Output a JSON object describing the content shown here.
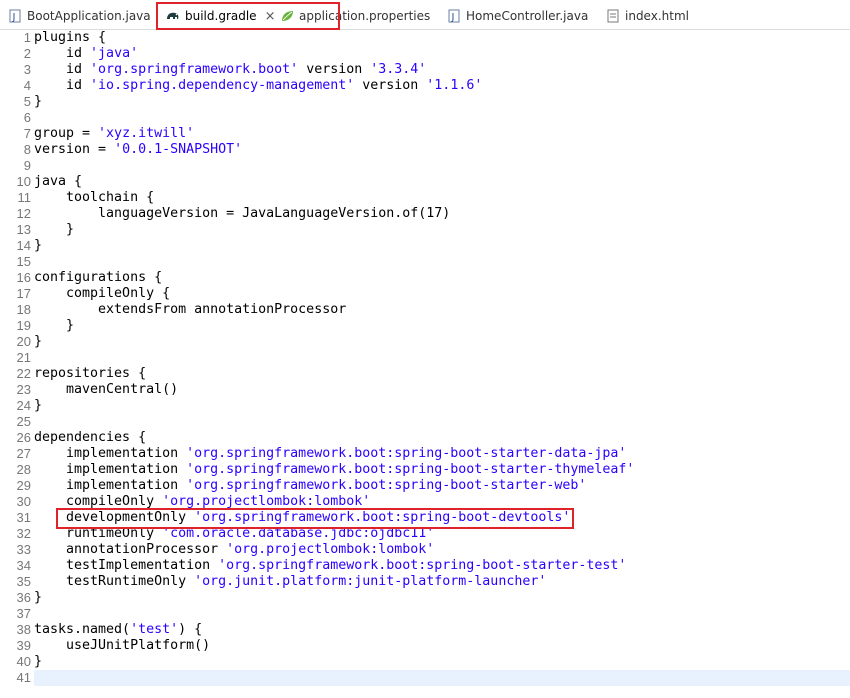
{
  "tabs": [
    {
      "label": "BootApplication.java",
      "icon": "java-file-icon",
      "active": false
    },
    {
      "label": "build.gradle",
      "icon": "gradle-elephant-icon",
      "active": true,
      "close": "×"
    },
    {
      "label": "application.properties",
      "icon": "spring-leaf-icon",
      "active": false
    },
    {
      "label": "HomeController.java",
      "icon": "java-file-icon",
      "active": false
    },
    {
      "label": "index.html",
      "icon": "html-file-icon",
      "active": false
    }
  ],
  "colors": {
    "string": "#2a00ff",
    "line_number": "#787878",
    "highlight_border": "#e0222a",
    "current_line": "#e8f2fe"
  },
  "editor": {
    "lines": [
      {
        "n": "1",
        "tokens": [
          [
            "plugins {",
            "p"
          ]
        ]
      },
      {
        "n": "2",
        "tokens": [
          [
            "    id ",
            "p"
          ],
          [
            "'java'",
            "s"
          ]
        ]
      },
      {
        "n": "3",
        "tokens": [
          [
            "    id ",
            "p"
          ],
          [
            "'org.springframework.boot'",
            "s"
          ],
          [
            " version ",
            "p"
          ],
          [
            "'3.3.4'",
            "s"
          ]
        ]
      },
      {
        "n": "4",
        "tokens": [
          [
            "    id ",
            "p"
          ],
          [
            "'io.spring.dependency-management'",
            "s"
          ],
          [
            " version ",
            "p"
          ],
          [
            "'1.1.6'",
            "s"
          ]
        ]
      },
      {
        "n": "5",
        "tokens": [
          [
            "}",
            "p"
          ]
        ]
      },
      {
        "n": "6",
        "tokens": []
      },
      {
        "n": "7",
        "tokens": [
          [
            "group = ",
            "p"
          ],
          [
            "'xyz.itwill'",
            "s"
          ]
        ]
      },
      {
        "n": "8",
        "tokens": [
          [
            "version = ",
            "p"
          ],
          [
            "'0.0.1-SNAPSHOT'",
            "s"
          ]
        ]
      },
      {
        "n": "9",
        "tokens": []
      },
      {
        "n": "10",
        "tokens": [
          [
            "java {",
            "p"
          ]
        ]
      },
      {
        "n": "11",
        "tokens": [
          [
            "    toolchain {",
            "p"
          ]
        ]
      },
      {
        "n": "12",
        "tokens": [
          [
            "        languageVersion = JavaLanguageVersion.of(17)",
            "p"
          ]
        ]
      },
      {
        "n": "13",
        "tokens": [
          [
            "    }",
            "p"
          ]
        ]
      },
      {
        "n": "14",
        "tokens": [
          [
            "}",
            "p"
          ]
        ]
      },
      {
        "n": "15",
        "tokens": []
      },
      {
        "n": "16",
        "tokens": [
          [
            "configurations {",
            "p"
          ]
        ]
      },
      {
        "n": "17",
        "tokens": [
          [
            "    compileOnly {",
            "p"
          ]
        ]
      },
      {
        "n": "18",
        "tokens": [
          [
            "        extendsFrom annotationProcessor",
            "p"
          ]
        ]
      },
      {
        "n": "19",
        "tokens": [
          [
            "    }",
            "p"
          ]
        ]
      },
      {
        "n": "20",
        "tokens": [
          [
            "}",
            "p"
          ]
        ]
      },
      {
        "n": "21",
        "tokens": []
      },
      {
        "n": "22",
        "tokens": [
          [
            "repositories {",
            "p"
          ]
        ]
      },
      {
        "n": "23",
        "tokens": [
          [
            "    mavenCentral()",
            "p"
          ]
        ]
      },
      {
        "n": "24",
        "tokens": [
          [
            "}",
            "p"
          ]
        ]
      },
      {
        "n": "25",
        "tokens": []
      },
      {
        "n": "26",
        "tokens": [
          [
            "dependencies {",
            "p"
          ]
        ]
      },
      {
        "n": "27",
        "tokens": [
          [
            "    implementation ",
            "p"
          ],
          [
            "'org.springframework.boot:spring-boot-starter-data-jpa'",
            "s"
          ]
        ]
      },
      {
        "n": "28",
        "tokens": [
          [
            "    implementation ",
            "p"
          ],
          [
            "'org.springframework.boot:spring-boot-starter-thymeleaf'",
            "s"
          ]
        ]
      },
      {
        "n": "29",
        "tokens": [
          [
            "    implementation ",
            "p"
          ],
          [
            "'org.springframework.boot:spring-boot-starter-web'",
            "s"
          ]
        ]
      },
      {
        "n": "30",
        "tokens": [
          [
            "    compileOnly ",
            "p"
          ],
          [
            "'org.projectlombok:lombok'",
            "s"
          ]
        ]
      },
      {
        "n": "31",
        "tokens": [
          [
            "    developmentOnly ",
            "p"
          ],
          [
            "'org.springframework.boot:spring-boot-devtools'",
            "s"
          ]
        ]
      },
      {
        "n": "32",
        "tokens": [
          [
            "    runtimeOnly ",
            "p"
          ],
          [
            "'com.oracle.database.jdbc:ojdbc11'",
            "s"
          ]
        ]
      },
      {
        "n": "33",
        "tokens": [
          [
            "    annotationProcessor ",
            "p"
          ],
          [
            "'org.projectlombok:lombok'",
            "s"
          ]
        ]
      },
      {
        "n": "34",
        "tokens": [
          [
            "    testImplementation ",
            "p"
          ],
          [
            "'org.springframework.boot:spring-boot-starter-test'",
            "s"
          ]
        ]
      },
      {
        "n": "35",
        "tokens": [
          [
            "    testRuntimeOnly ",
            "p"
          ],
          [
            "'org.junit.platform:junit-platform-launcher'",
            "s"
          ]
        ]
      },
      {
        "n": "36",
        "tokens": [
          [
            "}",
            "p"
          ]
        ]
      },
      {
        "n": "37",
        "tokens": []
      },
      {
        "n": "38",
        "tokens": [
          [
            "tasks.named(",
            "p"
          ],
          [
            "'test'",
            "s"
          ],
          [
            ") {",
            "p"
          ]
        ]
      },
      {
        "n": "39",
        "tokens": [
          [
            "    useJUnitPlatform()",
            "p"
          ]
        ]
      },
      {
        "n": "40",
        "tokens": [
          [
            "}",
            "p"
          ]
        ]
      },
      {
        "n": "41",
        "tokens": []
      }
    ]
  }
}
